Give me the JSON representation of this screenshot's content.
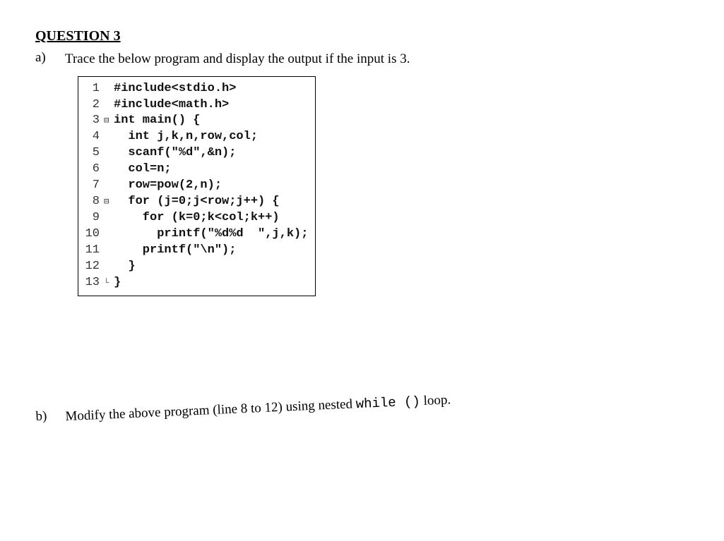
{
  "heading": "QUESTION 3",
  "part_a": {
    "label": "a)",
    "prompt": "Trace the below program and display the output if the input is 3."
  },
  "code": [
    {
      "n": "1",
      "fold": "",
      "t": "#include<stdio.h>"
    },
    {
      "n": "2",
      "fold": "",
      "t": "#include<math.h>"
    },
    {
      "n": "3",
      "fold": "⊟",
      "t": "int main() {"
    },
    {
      "n": "4",
      "fold": "",
      "t": "  int j,k,n,row,col;"
    },
    {
      "n": "5",
      "fold": "",
      "t": "  scanf(\"%d\",&n);"
    },
    {
      "n": "6",
      "fold": "",
      "t": "  col=n;"
    },
    {
      "n": "7",
      "fold": "",
      "t": "  row=pow(2,n);"
    },
    {
      "n": "8",
      "fold": "⊟",
      "t": "  for (j=0;j<row;j++) {"
    },
    {
      "n": "9",
      "fold": "",
      "t": "    for (k=0;k<col;k++)"
    },
    {
      "n": "10",
      "fold": "",
      "t": "      printf(\"%d%d  \",j,k);"
    },
    {
      "n": "11",
      "fold": "",
      "t": "    printf(\"\\n\");"
    },
    {
      "n": "12",
      "fold": "",
      "t": "  }"
    },
    {
      "n": "13",
      "fold": "└",
      "t": "}"
    }
  ],
  "part_b": {
    "label": "b)",
    "prompt_pre": "Modify the above program (line 8 to 12) using nested ",
    "mono": "while ()",
    "prompt_post": " loop."
  }
}
